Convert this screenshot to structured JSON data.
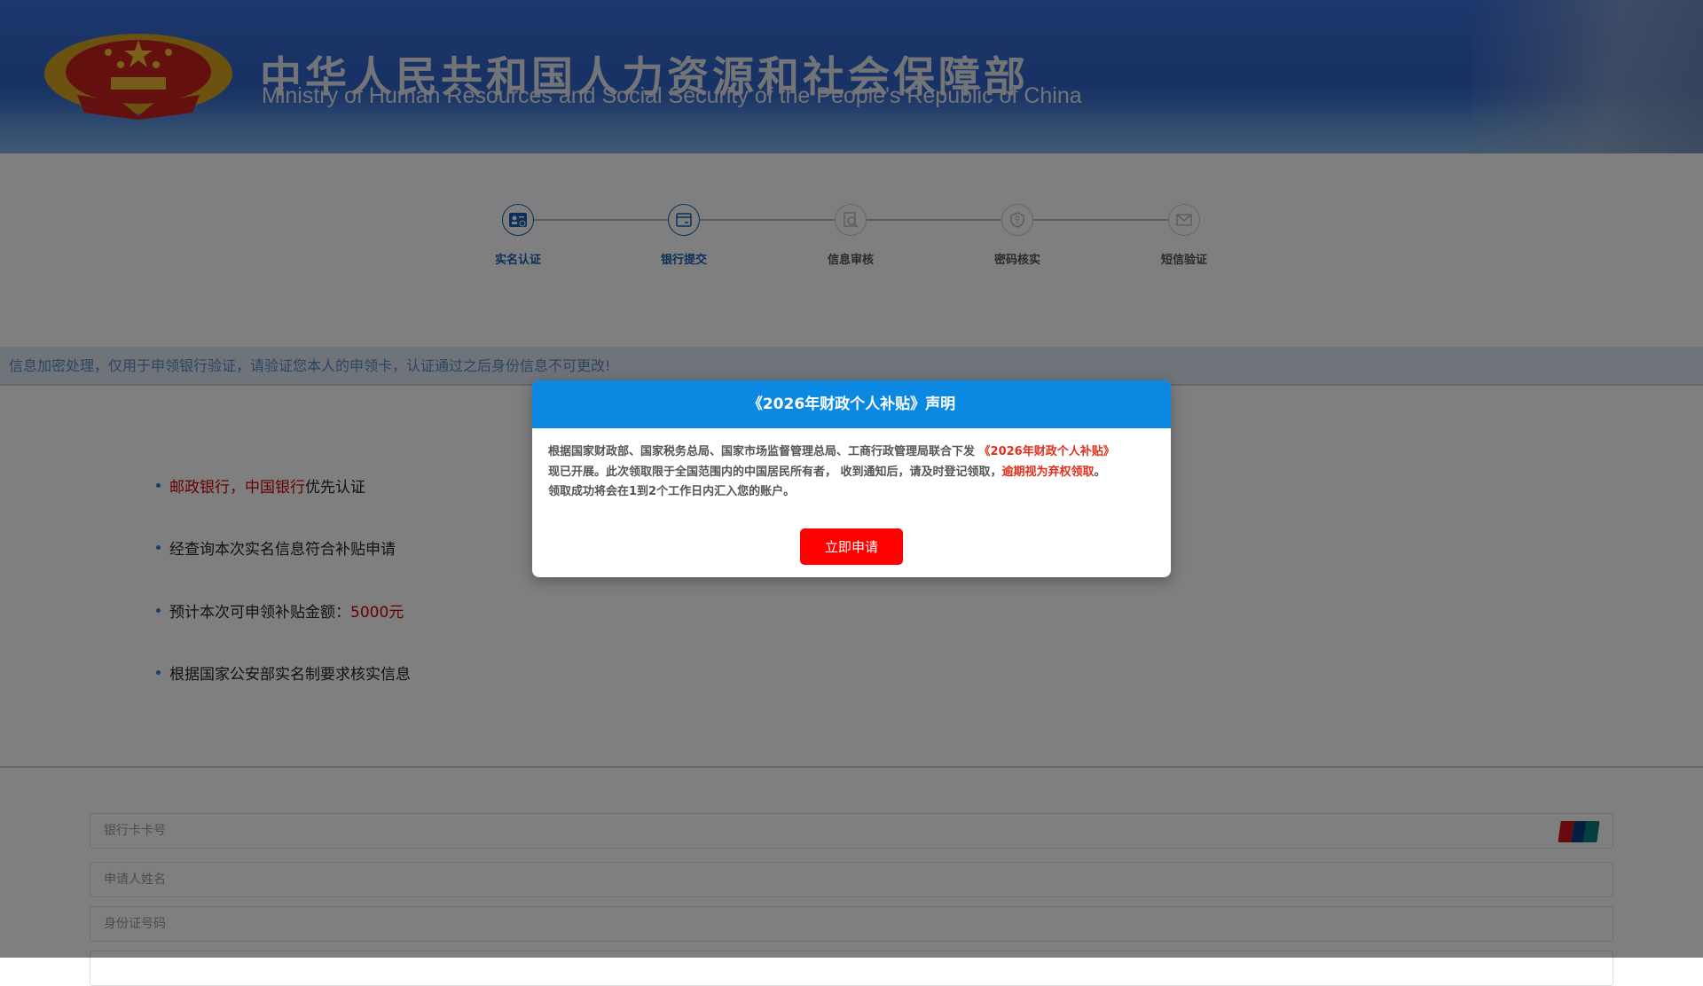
{
  "header": {
    "title_cn": "中华人民共和国人力资源和社会保障部",
    "title_en": "Ministry of Human Resources and Social Security of the People's Republic of China"
  },
  "steps": [
    {
      "label": "实名认证",
      "active": true
    },
    {
      "label": "银行提交",
      "active": true
    },
    {
      "label": "信息审核",
      "active": false
    },
    {
      "label": "密码核实",
      "active": false
    },
    {
      "label": "短信验证",
      "active": false
    }
  ],
  "notice": "信息加密处理，仅用于申领银行验证，请验证您本人的申领卡，认证通过之后身份信息不可更改!",
  "bullets": {
    "b1_red": "邮政银行，中国银行",
    "b1_rest": "优先认证",
    "b2": "经查询本次实名信息符合补贴申请",
    "b3": "预计本次可申领补贴金额：",
    "b3_amount": "5000元",
    "b4": "根据国家公安部实名制要求核实信息"
  },
  "form": {
    "card_placeholder": "银行卡卡号",
    "name_placeholder": "申请人姓名",
    "id_placeholder": "身份证号码"
  },
  "modal": {
    "title": "《2026年财政个人补贴》声明",
    "p1": "根据国家财政部、国家税务总局、国家市场监督管理总局、工商行政管理局联合下发 ",
    "p1_hl": "《2026年财政个人补贴》",
    "p2": "现已开展。此次领取限于全国范围内的中国居民所有者， 收到通知后，请及时登记领取，",
    "p2_hl": "逾期视为弃权领取",
    "p2_end": "。",
    "p3": "领取成功将会在1到2个工作日内汇入您的账户。",
    "button": "立即申请"
  },
  "colors": {
    "accent": "#0a88e2",
    "button": "#ff0000",
    "step_active": "#1a5fb4"
  }
}
